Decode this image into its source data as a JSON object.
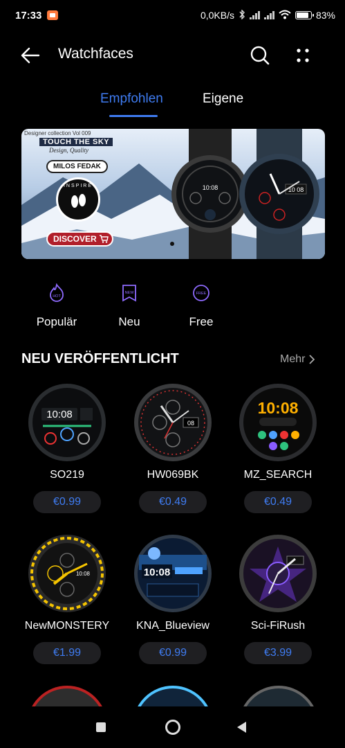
{
  "status_bar": {
    "time": "17:33",
    "network_speed": "0,0KB/s",
    "battery_percent": "83%",
    "battery_level": 0.83
  },
  "header": {
    "title": "Watchfaces",
    "back_icon": "arrow-left-icon",
    "search_icon": "search-icon",
    "more_icon": "more-vertical-icon"
  },
  "tabs": [
    {
      "label": "Empfohlen",
      "active": true
    },
    {
      "label": "Eigene",
      "active": false
    }
  ],
  "banner": {
    "collection": "Designer collection Vol 009",
    "headline": "TOUCH THE SKY",
    "tagline": "Design, Quality",
    "author": "MILOS FEDAK",
    "logo_text": "INSPIRE",
    "cta": "DISCOVER",
    "watch_left_time": "10:08",
    "watch_right_time": "10 08"
  },
  "categories": [
    {
      "label": "Populär",
      "icon": "hot-badge-icon",
      "badge": "HOT"
    },
    {
      "label": "Neu",
      "icon": "new-badge-icon",
      "badge": "NEW"
    },
    {
      "label": "Free",
      "icon": "free-badge-icon",
      "badge": "FREE"
    }
  ],
  "section": {
    "title": "NEU VERÖFFENTLICHT",
    "more_label": "Mehr"
  },
  "watchfaces": [
    {
      "name": "SO219",
      "price": "€0.99",
      "face_time": "10:08",
      "accent": "#2ec27e"
    },
    {
      "name": "HW069BK",
      "price": "€0.49",
      "face_time": "08",
      "accent": "#d33"
    },
    {
      "name": "MZ_SEARCH",
      "price": "€0.49",
      "face_time": "10:08",
      "accent": "#ffb000"
    },
    {
      "name": "NewMONSTERY",
      "price": "€1.99",
      "face_time": "10:08",
      "accent": "#f5c400"
    },
    {
      "name": "KNA_Blueview",
      "price": "€0.99",
      "face_time": "10:08",
      "accent": "#4fa3ff"
    },
    {
      "name": "Sci-FiRush",
      "price": "€3.99",
      "face_time": "",
      "accent": "#8a5cff"
    }
  ],
  "colors": {
    "accent_blue": "#3f7cf2",
    "background": "#000000",
    "price_pill": "#1f1f22"
  }
}
